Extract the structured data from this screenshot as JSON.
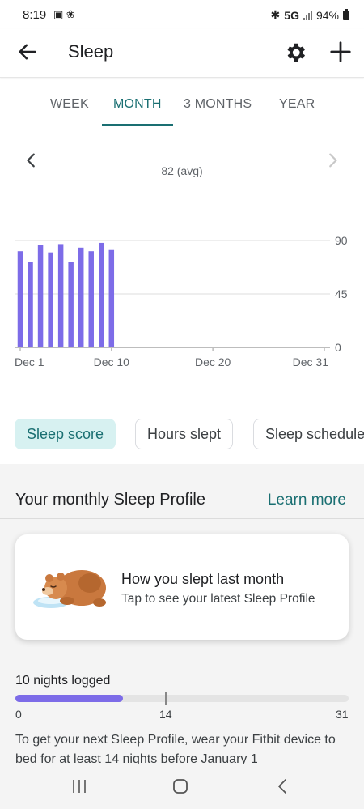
{
  "status_bar": {
    "time": "8:19",
    "left_icons": "▣ ❀",
    "bluetooth": "✱",
    "network": "5G",
    "battery": "94%"
  },
  "app_bar": {
    "title": "Sleep",
    "icons": [
      "back-arrow-icon",
      "gear-icon",
      "plus-icon"
    ]
  },
  "tabs": [
    {
      "label": "WEEK",
      "active": false
    },
    {
      "label": "MONTH",
      "active": true
    },
    {
      "label": "3 MONTHS",
      "active": false
    },
    {
      "label": "YEAR",
      "active": false
    }
  ],
  "chart_header": {
    "avg_label": "82 (avg)"
  },
  "chart_data": {
    "type": "bar",
    "x": [
      1,
      2,
      3,
      4,
      5,
      6,
      7,
      8,
      9,
      10
    ],
    "values": [
      81,
      72,
      86,
      80,
      87,
      72,
      84,
      81,
      88,
      82
    ],
    "ylim": [
      0,
      90
    ],
    "xlim": [
      1,
      31
    ],
    "y_ticks": [
      {
        "value": 90,
        "label": "90"
      },
      {
        "value": 45,
        "label": "45"
      },
      {
        "value": 0,
        "label": "0"
      }
    ],
    "x_ticks": [
      {
        "day": 1,
        "label": "Dec 1"
      },
      {
        "day": 10,
        "label": "Dec 10"
      },
      {
        "day": 20,
        "label": "Dec 20"
      },
      {
        "day": 31,
        "label": "Dec 31"
      }
    ],
    "bar_color": "#7d6ce8",
    "grid": true
  },
  "chips": [
    {
      "label": "Sleep score",
      "selected": true
    },
    {
      "label": "Hours slept",
      "selected": false
    },
    {
      "label": "Sleep schedule",
      "selected": false
    }
  ],
  "profile": {
    "title": "Your monthly Sleep Profile",
    "learn_more": "Learn more",
    "card_title": "How you slept last month",
    "card_subtitle": "Tap to see your latest Sleep Profile",
    "nights_logged": "10 nights logged",
    "progress": {
      "value": 10,
      "max": 31,
      "marker": 14,
      "labels": [
        "0",
        "14",
        "31"
      ]
    },
    "footnote": "To get your next Sleep Profile, wear your Fitbit device to bed for at least 14 nights before January 1"
  },
  "colors": {
    "accent": "#1a6f72",
    "bar": "#7d6ce8",
    "chip_selected_bg": "#d7f1f1"
  }
}
